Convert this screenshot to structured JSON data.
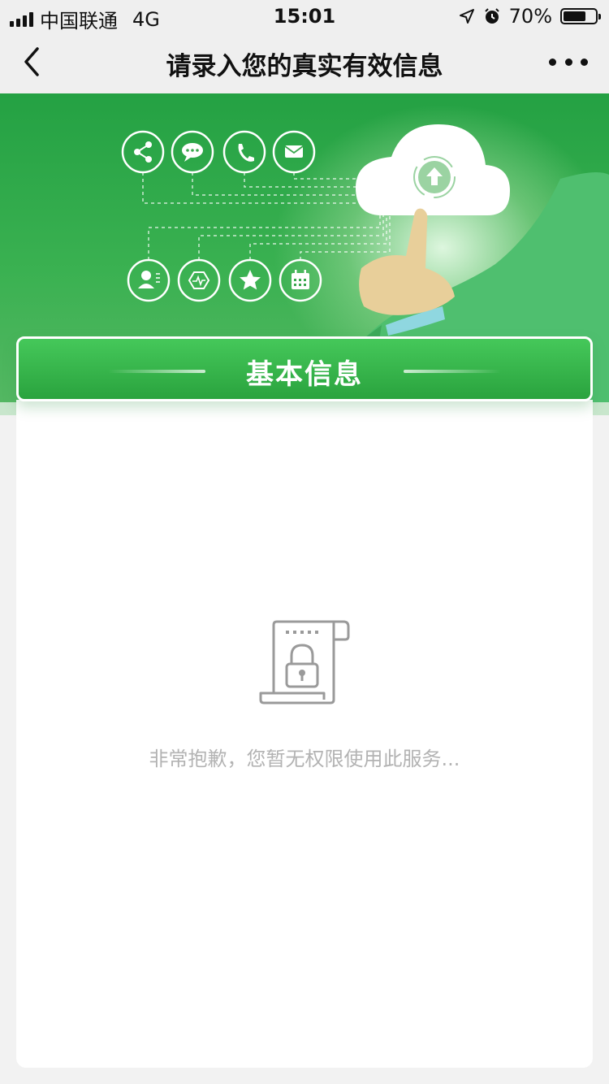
{
  "status_bar": {
    "carrier": "中国联通",
    "network": "4G",
    "time": "15:01",
    "battery": "70%",
    "battery_level": 0.7,
    "icons": [
      "signal-icon",
      "location-arrow-icon",
      "alarm-icon",
      "battery-icon"
    ]
  },
  "nav": {
    "title": "请录入您的真实有效信息",
    "back_icon": "chevron-left-icon",
    "more_icon": "more-dots-icon"
  },
  "banner": {
    "top_icons": [
      "share-icon",
      "chat-icon",
      "phone-icon",
      "mail-icon"
    ],
    "bottom_icons": [
      "contact-icon",
      "activity-icon",
      "star-icon",
      "calendar-icon"
    ],
    "cloud_icon": "cloud-upload-icon"
  },
  "section": {
    "title": "基本信息"
  },
  "empty_state": {
    "icon": "locked-document-icon",
    "message": "非常抱歉，您暂无权限使用此服务..."
  },
  "colors": {
    "brand_green": "#2aa33e",
    "banner_green": "#24a143",
    "message_gray": "#b3b3b3"
  }
}
